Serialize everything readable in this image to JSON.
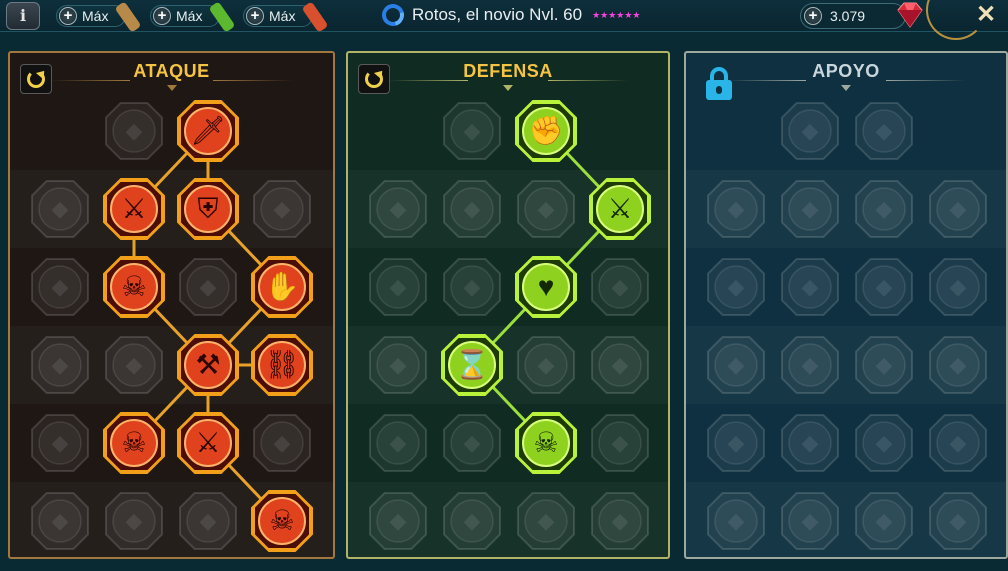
{
  "topbar": {
    "info_icon": "info-icon",
    "potions": [
      {
        "label": "Máx",
        "color": "#b88a4a"
      },
      {
        "label": "Máx",
        "color": "#5cb82e"
      },
      {
        "label": "Máx",
        "color": "#d8502e"
      }
    ],
    "champion_name": "Rotos, el novio Nvl. 60",
    "stars": "★★★★★★",
    "gems_value": "3.079",
    "close_label": "✕"
  },
  "colors": {
    "attack_active": "#e0421d",
    "defense_active": "#8ed21f",
    "support_title": "#c9d6dc",
    "attack_title": "#f5c542",
    "defense_title": "#f5c542"
  },
  "panels": {
    "attack": {
      "title": "ATAQUE",
      "rows": [
        [
          {
            "icon": "crossed-swords-icon",
            "state": "locked"
          },
          {
            "icon": "dagger-icon",
            "state": "active",
            "glyph": "🗡"
          }
        ],
        [
          {
            "icon": "horned-figure-icon",
            "state": "locked"
          },
          {
            "icon": "flaming-sword-icon",
            "state": "active",
            "glyph": "⚔"
          },
          {
            "icon": "shield-strike-icon",
            "state": "active",
            "glyph": "⛨"
          },
          {
            "icon": "heart-crest-icon",
            "state": "locked"
          }
        ],
        [
          {
            "icon": "hammer-strike-icon",
            "state": "locked"
          },
          {
            "icon": "fanged-mouth-icon",
            "state": "active",
            "glyph": "☠"
          },
          {
            "icon": "hooded-skull-icon",
            "state": "locked"
          },
          {
            "icon": "claw-hand-icon",
            "state": "active",
            "glyph": "✋"
          }
        ],
        [
          {
            "icon": "heart-helm-icon",
            "state": "locked"
          },
          {
            "icon": "fist-icon",
            "state": "locked"
          },
          {
            "icon": "axe-icon",
            "state": "active",
            "glyph": "⚒"
          },
          {
            "icon": "broken-chain-icon",
            "state": "active",
            "glyph": "⛓"
          }
        ],
        [
          {
            "icon": "claw-slash-icon",
            "state": "locked"
          },
          {
            "icon": "twin-skulls-icon",
            "state": "active",
            "glyph": "☠"
          },
          {
            "icon": "sword-ring-icon",
            "state": "active",
            "glyph": "⚔"
          },
          {
            "icon": "muscle-figure-icon",
            "state": "locked"
          }
        ],
        [
          {
            "icon": "sword-thrust-icon",
            "state": "locked"
          },
          {
            "icon": "knight-helm-icon",
            "state": "locked"
          },
          {
            "icon": "demon-icon",
            "state": "locked"
          },
          {
            "icon": "burning-skull-icon",
            "state": "active",
            "glyph": "☠"
          }
        ]
      ]
    },
    "defense": {
      "title": "DEFENSA",
      "rows": [
        [
          {
            "icon": "shield-plates-icon",
            "state": "locked"
          },
          {
            "icon": "raised-fist-icon",
            "state": "active",
            "glyph": "✊"
          }
        ],
        [
          {
            "icon": "chevron-armor-icon",
            "state": "locked"
          },
          {
            "icon": "heart-hand-icon",
            "state": "locked"
          },
          {
            "icon": "armored-torso-icon",
            "state": "locked"
          },
          {
            "icon": "deflect-blades-icon",
            "state": "active",
            "glyph": "⚔"
          }
        ],
        [
          {
            "icon": "figure-aura-icon",
            "state": "locked"
          },
          {
            "icon": "knight-sword-icon",
            "state": "locked"
          },
          {
            "icon": "skull-heart-icon",
            "state": "active",
            "glyph": "♥"
          },
          {
            "icon": "hooded-face-icon",
            "state": "locked"
          }
        ],
        [
          {
            "icon": "crowd-icon",
            "state": "locked"
          },
          {
            "icon": "skull-hourglass-icon",
            "state": "active",
            "glyph": "⌛"
          },
          {
            "icon": "palm-icon",
            "state": "locked"
          },
          {
            "icon": "bull-head-icon",
            "state": "locked"
          }
        ],
        [
          {
            "icon": "runner-icon",
            "state": "locked"
          },
          {
            "icon": "flame-drops-icon",
            "state": "locked"
          },
          {
            "icon": "spiked-skull-icon",
            "state": "active",
            "glyph": "☠"
          },
          {
            "icon": "swirl-shield-icon",
            "state": "locked"
          }
        ],
        [
          {
            "icon": "ghoul-icon",
            "state": "locked"
          },
          {
            "icon": "winged-shield-icon",
            "state": "locked"
          },
          {
            "icon": "warrior-face-icon",
            "state": "locked"
          },
          {
            "icon": "brute-icon",
            "state": "locked"
          }
        ]
      ]
    },
    "support": {
      "title": "APOYO",
      "rows": [
        [
          {
            "icon": "heart-sparkle-icon",
            "state": "locked"
          },
          {
            "icon": "swirl-eye-icon",
            "state": "locked"
          }
        ],
        [
          {
            "icon": "praying-hands-icon",
            "state": "locked"
          },
          {
            "icon": "dome-shield-icon",
            "state": "locked"
          },
          {
            "icon": "flame-skull-icon",
            "state": "locked"
          },
          {
            "icon": "swift-strike-icon",
            "state": "locked"
          }
        ],
        [
          {
            "icon": "sparkle-figure-icon",
            "state": "locked"
          },
          {
            "icon": "lightning-icon",
            "state": "locked"
          },
          {
            "icon": "bent-figure-icon",
            "state": "locked"
          },
          {
            "icon": "standing-figure-icon",
            "state": "locked"
          }
        ],
        [
          {
            "icon": "heart-icon",
            "state": "locked"
          },
          {
            "icon": "chain-link-icon",
            "state": "locked"
          },
          {
            "icon": "open-book-icon",
            "state": "locked"
          },
          {
            "icon": "angry-face-icon",
            "state": "locked"
          }
        ],
        [
          {
            "icon": "compass-star-icon",
            "state": "locked"
          },
          {
            "icon": "dash-boot-icon",
            "state": "locked"
          },
          {
            "icon": "eye-icon",
            "state": "locked"
          },
          {
            "icon": "dancer-icon",
            "state": "locked"
          }
        ],
        [
          {
            "icon": "potion-flask-icon",
            "state": "locked"
          },
          {
            "icon": "skull-icon",
            "state": "locked"
          },
          {
            "icon": "fortress-icon",
            "state": "locked"
          },
          {
            "icon": "eagle-icon",
            "state": "locked"
          }
        ]
      ]
    }
  }
}
